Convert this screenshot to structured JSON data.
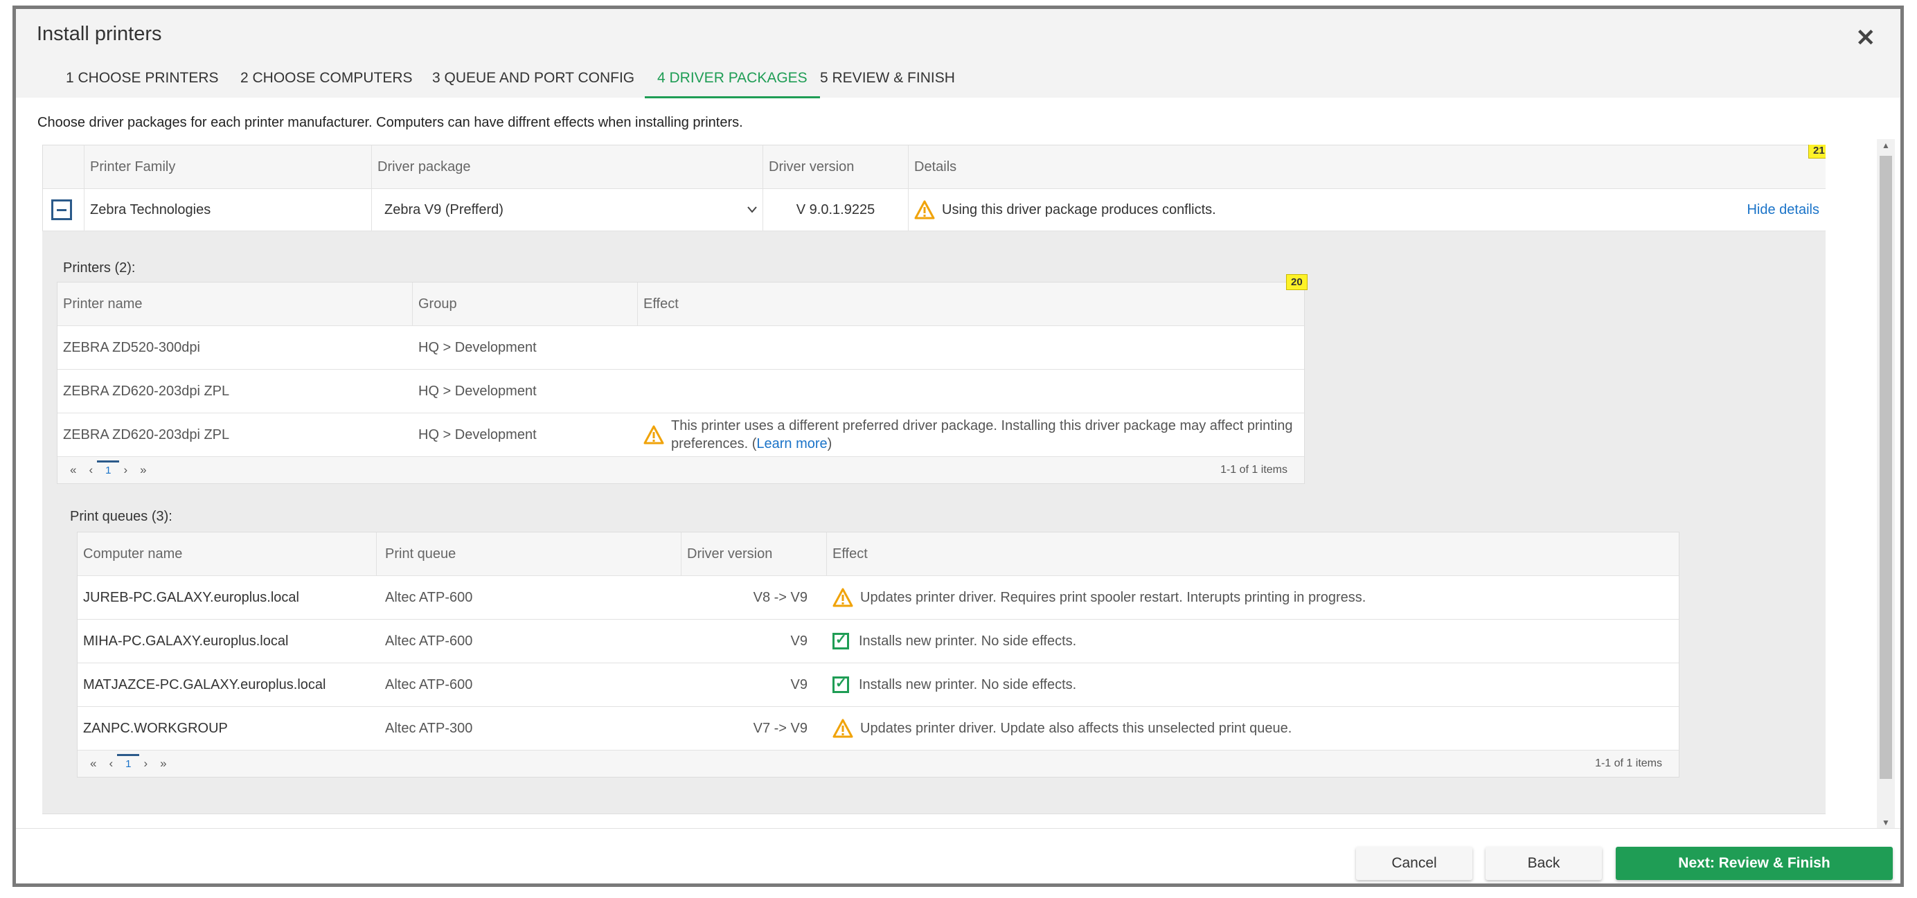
{
  "dialog": {
    "title": "Install printers"
  },
  "tabs": [
    {
      "label": "1 CHOOSE PRINTERS"
    },
    {
      "label": "2 CHOOSE COMPUTERS"
    },
    {
      "label": "3 QUEUE AND PORT CONFIG"
    },
    {
      "label": "4 DRIVER PACKAGES"
    },
    {
      "label": "5 REVIEW & FINISH"
    }
  ],
  "active_tab": 3,
  "instruction": "Choose driver packages for each printer manufacturer. Computers can have diffrent effects when installing printers.",
  "main_table": {
    "badge": "21",
    "columns": [
      "Printer Family",
      "Driver package",
      "Driver version",
      "Details"
    ],
    "row": {
      "family": "Zebra Technologies",
      "driver_package": "Zebra V9 (Prefferd)",
      "driver_version": "V 9.0.1.9225",
      "details": "Using this driver package produces conflicts.",
      "hide_details": "Hide details"
    }
  },
  "printers": {
    "title": "Printers (2):",
    "badge": "20",
    "columns": [
      "Printer name",
      "Group",
      "Effect"
    ],
    "rows": [
      {
        "name": "ZEBRA ZD520-300dpi",
        "group": "HQ > Development",
        "effect": ""
      },
      {
        "name": "ZEBRA ZD620-203dpi ZPL",
        "group": "HQ > Development",
        "effect": ""
      },
      {
        "name": "ZEBRA ZD620-203dpi ZPL",
        "group": "HQ > Development",
        "effect": "This printer uses a different preferred driver package. Installing this driver package may affect printing preferences.",
        "learn_more": "Learn more"
      }
    ],
    "pager": {
      "page": "1",
      "info": "1-1 of 1 items"
    }
  },
  "print_queues": {
    "title": "Print queues (3):",
    "columns": [
      "Computer name",
      "Print queue",
      "Driver version",
      "Effect"
    ],
    "rows": [
      {
        "computer": "JUREB-PC.GALAXY.europlus.local",
        "queue": "Altec ATP-600",
        "version": "V8 -> V9",
        "status": "warning",
        "effect": "Updates printer driver. Requires print spooler restart. Interupts printing in progress."
      },
      {
        "computer": "MIHA-PC.GALAXY.europlus.local",
        "queue": "Altec ATP-600",
        "version": "V9",
        "status": "ok",
        "effect": "Installs new printer. No side effects."
      },
      {
        "computer": "MATJAZCE-PC.GALAXY.europlus.local",
        "queue": "Altec ATP-600",
        "version": "V9",
        "status": "ok",
        "effect": "Installs new printer. No side effects."
      },
      {
        "computer": "ZANPC.WORKGROUP",
        "queue": "Altec ATP-300",
        "version": "V7 -> V9",
        "status": "warning",
        "effect": "Updates printer driver. Update also affects this unselected print queue."
      }
    ],
    "pager": {
      "page": "1",
      "info": "1-1 of 1 items"
    }
  },
  "footer": {
    "cancel": "Cancel",
    "back": "Back",
    "next": "Next: Review & Finish"
  },
  "colors": {
    "accent": "#1f9d55",
    "link": "#1a73c8",
    "warning": "#f0a30a",
    "badge": "#fdf228"
  },
  "icons": {
    "close": "close-icon",
    "warning": "warning-icon",
    "collapse": "collapse-icon",
    "check": "check-icon",
    "dropdown": "chevron-down-icon"
  }
}
